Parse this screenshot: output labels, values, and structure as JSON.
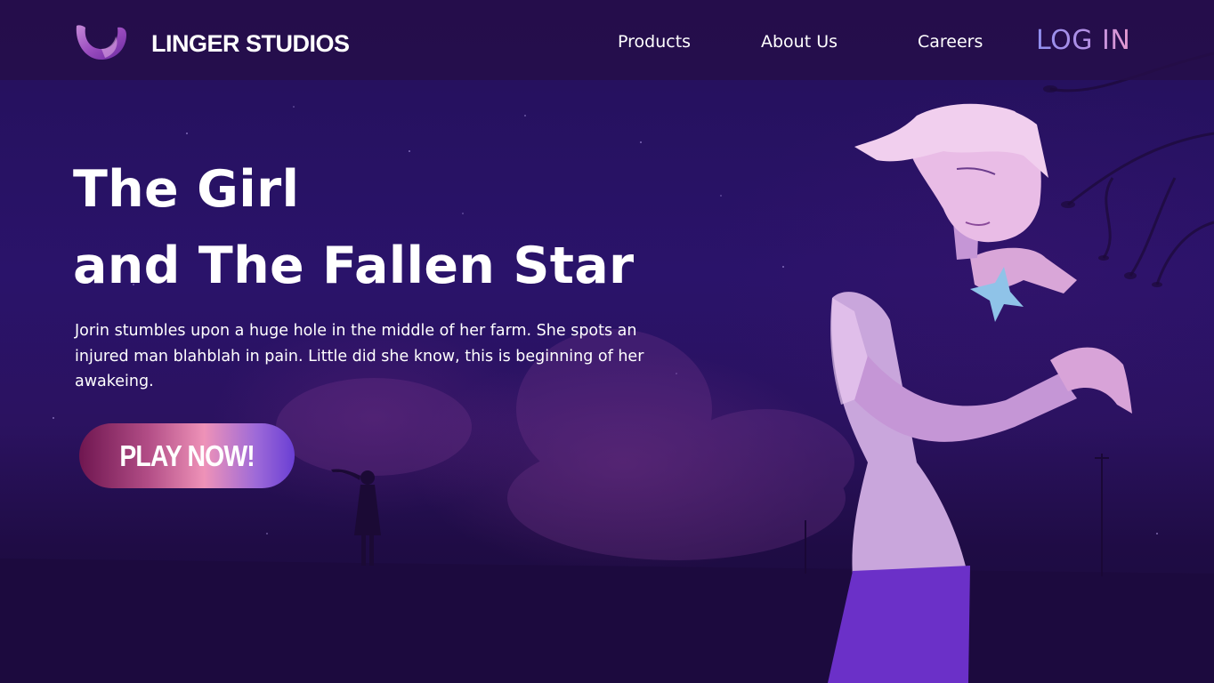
{
  "header": {
    "brand_name": "LINGER STUDIOS",
    "logo_icon": "purple-u-icon",
    "nav": [
      {
        "label": "Products"
      },
      {
        "label": "About Us"
      },
      {
        "label": "Careers"
      }
    ],
    "login_label": "LOG IN"
  },
  "hero": {
    "title_line_1": "The Girl",
    "title_line_2": "and The Fallen Star",
    "description": "Jorin stumbles upon a huge hole in the middle of her farm. She spots an injured man blahblah in pain. Little did she know, this is beginning of her awakeing.",
    "cta_label": "PLAY NOW!"
  },
  "colors": {
    "background": "#24105a",
    "header": "#260e48",
    "accent_pink": "#ee92b8",
    "accent_violet": "#6a3fd4",
    "login_gradient_start": "#8f8ff0",
    "login_gradient_end": "#e79ad0"
  }
}
